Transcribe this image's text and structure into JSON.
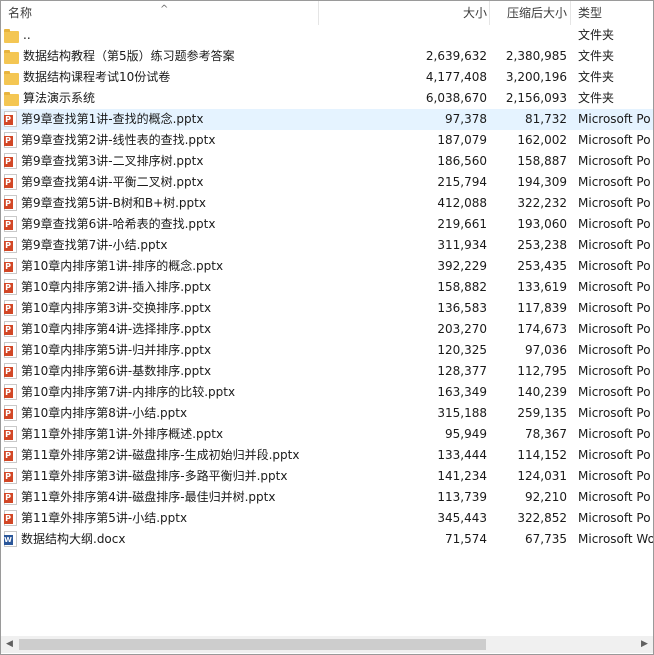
{
  "columns": {
    "name": "名称",
    "size": "大小",
    "compressed": "压缩后大小",
    "type": "类型"
  },
  "files": [
    {
      "name": "..",
      "size": "",
      "compressed": "",
      "type": "文件夹",
      "icon": "folder-icon"
    },
    {
      "name": "数据结构教程（第5版）练习题参考答案",
      "size": "2,639,632",
      "compressed": "2,380,985",
      "type": "文件夹",
      "icon": "folder-icon"
    },
    {
      "name": "数据结构课程考试10份试卷",
      "size": "4,177,408",
      "compressed": "3,200,196",
      "type": "文件夹",
      "icon": "folder-icon"
    },
    {
      "name": "算法演示系统",
      "size": "6,038,670",
      "compressed": "2,156,093",
      "type": "文件夹",
      "icon": "folder-icon"
    },
    {
      "name": "第9章查找第1讲-查找的概念.pptx",
      "size": "97,378",
      "compressed": "81,732",
      "type": "Microsoft Po",
      "icon": "powerpoint-file-icon"
    },
    {
      "name": "第9章查找第2讲-线性表的查找.pptx",
      "size": "187,079",
      "compressed": "162,002",
      "type": "Microsoft Po",
      "icon": "powerpoint-file-icon"
    },
    {
      "name": "第9章查找第3讲-二叉排序树.pptx",
      "size": "186,560",
      "compressed": "158,887",
      "type": "Microsoft Po",
      "icon": "powerpoint-file-icon"
    },
    {
      "name": "第9章查找第4讲-平衡二叉树.pptx",
      "size": "215,794",
      "compressed": "194,309",
      "type": "Microsoft Po",
      "icon": "powerpoint-file-icon"
    },
    {
      "name": "第9章查找第5讲-B树和B+树.pptx",
      "size": "412,088",
      "compressed": "322,232",
      "type": "Microsoft Po",
      "icon": "powerpoint-file-icon"
    },
    {
      "name": "第9章查找第6讲-哈希表的查找.pptx",
      "size": "219,661",
      "compressed": "193,060",
      "type": "Microsoft Po",
      "icon": "powerpoint-file-icon"
    },
    {
      "name": "第9章查找第7讲-小结.pptx",
      "size": "311,934",
      "compressed": "253,238",
      "type": "Microsoft Po",
      "icon": "powerpoint-file-icon"
    },
    {
      "name": "第10章内排序第1讲-排序的概念.pptx",
      "size": "392,229",
      "compressed": "253,435",
      "type": "Microsoft Po",
      "icon": "powerpoint-file-icon"
    },
    {
      "name": "第10章内排序第2讲-插入排序.pptx",
      "size": "158,882",
      "compressed": "133,619",
      "type": "Microsoft Po",
      "icon": "powerpoint-file-icon"
    },
    {
      "name": "第10章内排序第3讲-交换排序.pptx",
      "size": "136,583",
      "compressed": "117,839",
      "type": "Microsoft Po",
      "icon": "powerpoint-file-icon"
    },
    {
      "name": "第10章内排序第4讲-选择排序.pptx",
      "size": "203,270",
      "compressed": "174,673",
      "type": "Microsoft Po",
      "icon": "powerpoint-file-icon"
    },
    {
      "name": "第10章内排序第5讲-归并排序.pptx",
      "size": "120,325",
      "compressed": "97,036",
      "type": "Microsoft Po",
      "icon": "powerpoint-file-icon"
    },
    {
      "name": "第10章内排序第6讲-基数排序.pptx",
      "size": "128,377",
      "compressed": "112,795",
      "type": "Microsoft Po",
      "icon": "powerpoint-file-icon"
    },
    {
      "name": "第10章内排序第7讲-内排序的比较.pptx",
      "size": "163,349",
      "compressed": "140,239",
      "type": "Microsoft Po",
      "icon": "powerpoint-file-icon"
    },
    {
      "name": "第10章内排序第8讲-小结.pptx",
      "size": "315,188",
      "compressed": "259,135",
      "type": "Microsoft Po",
      "icon": "powerpoint-file-icon"
    },
    {
      "name": "第11章外排序第1讲-外排序概述.pptx",
      "size": "95,949",
      "compressed": "78,367",
      "type": "Microsoft Po",
      "icon": "powerpoint-file-icon"
    },
    {
      "name": "第11章外排序第2讲-磁盘排序-生成初始归并段.pptx",
      "size": "133,444",
      "compressed": "114,152",
      "type": "Microsoft Po",
      "icon": "powerpoint-file-icon"
    },
    {
      "name": "第11章外排序第3讲-磁盘排序-多路平衡归并.pptx",
      "size": "141,234",
      "compressed": "124,031",
      "type": "Microsoft Po",
      "icon": "powerpoint-file-icon"
    },
    {
      "name": "第11章外排序第4讲-磁盘排序-最佳归并树.pptx",
      "size": "113,739",
      "compressed": "92,210",
      "type": "Microsoft Po",
      "icon": "powerpoint-file-icon"
    },
    {
      "name": "第11章外排序第5讲-小结.pptx",
      "size": "345,443",
      "compressed": "322,852",
      "type": "Microsoft Po",
      "icon": "powerpoint-file-icon"
    },
    {
      "name": "数据结构大纲.docx",
      "size": "71,574",
      "compressed": "67,735",
      "type": "Microsoft Wo",
      "icon": "word-file-icon"
    }
  ],
  "hover_row": 4,
  "scrollbar": {
    "left_arrow": "◀",
    "right_arrow": "▶"
  }
}
